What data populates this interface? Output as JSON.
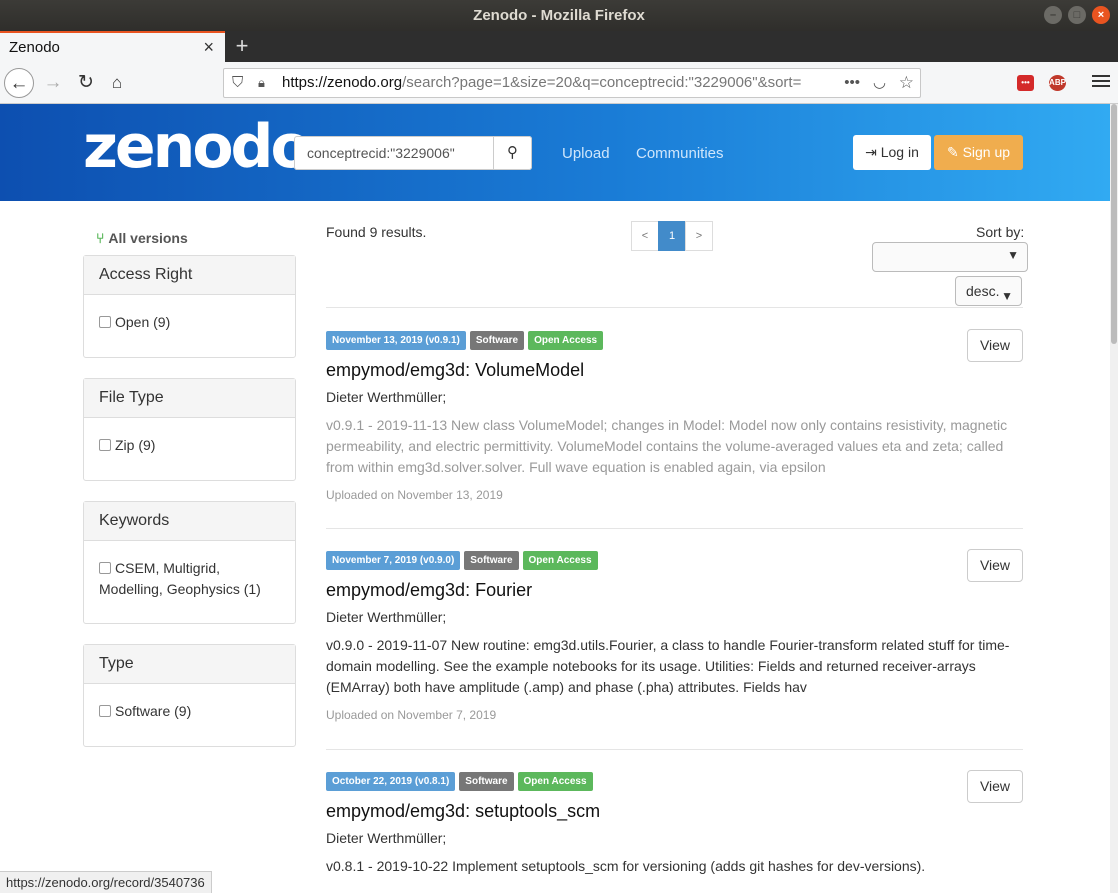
{
  "window": {
    "title": "Zenodo - Mozilla Firefox"
  },
  "tab": {
    "title": "Zenodo",
    "close": "×",
    "new": "+"
  },
  "url": {
    "domain": "https://zenodo.org",
    "path": "/search?page=1&size=20&q=conceptrecid:\"3229006\"&sort="
  },
  "header": {
    "logo": "zenodo",
    "search_value": "conceptrecid:\"3229006\"",
    "upload": "Upload",
    "communities": "Communities",
    "login": "Log in",
    "signup": "Sign up"
  },
  "sidebar": {
    "all_versions": "All versions",
    "facets": [
      {
        "title": "Access Right",
        "option": "Open (9)"
      },
      {
        "title": "File Type",
        "option": "Zip (9)"
      },
      {
        "title": "Keywords",
        "option": "CSEM, Multigrid, Modelling, Geophysics (1)"
      },
      {
        "title": "Type",
        "option": "Software (9)"
      }
    ]
  },
  "results": {
    "found": "Found 9 results.",
    "pager": {
      "prev": "<",
      "current": "1",
      "next": ">"
    },
    "sort_by": "Sort by:",
    "order": "desc.",
    "records": [
      {
        "date": "November 13, 2019 (v0.9.1)",
        "type": "Software",
        "access": "Open Access",
        "title": "empymod/emg3d: VolumeModel",
        "author": "Dieter Werthmüller;",
        "desc": "v0.9.1 - 2019-11-13 New class VolumeModel; changes in Model: Model now only contains resistivity, magnetic permeability, and electric permittivity. VolumeModel contains the volume-averaged values eta and zeta; called from within emg3d.solver.solver. Full wave equation is enabled again, via epsilon",
        "uploaded": "Uploaded on November 13, 2019",
        "view": "View"
      },
      {
        "date": "November 7, 2019 (v0.9.0)",
        "type": "Software",
        "access": "Open Access",
        "title": "empymod/emg3d: Fourier",
        "author": "Dieter Werthmüller;",
        "desc": "v0.9.0 - 2019-11-07 New routine: emg3d.utils.Fourier, a class to handle Fourier-transform related stuff for time-domain modelling. See the example notebooks for its usage. Utilities: Fields and returned receiver-arrays (EMArray) both have amplitude (.amp) and phase (.pha) attributes. Fields hav",
        "uploaded": "Uploaded on November 7, 2019",
        "view": "View"
      },
      {
        "date": "October 22, 2019 (v0.8.1)",
        "type": "Software",
        "access": "Open Access",
        "title": "empymod/emg3d: setuptools_scm",
        "author": "Dieter Werthmüller;",
        "desc": "v0.8.1 - 2019-10-22 Implement setuptools_scm for versioning (adds git hashes for dev-versions).",
        "view": "View"
      }
    ]
  },
  "statusbar": "https://zenodo.org/record/3540736"
}
